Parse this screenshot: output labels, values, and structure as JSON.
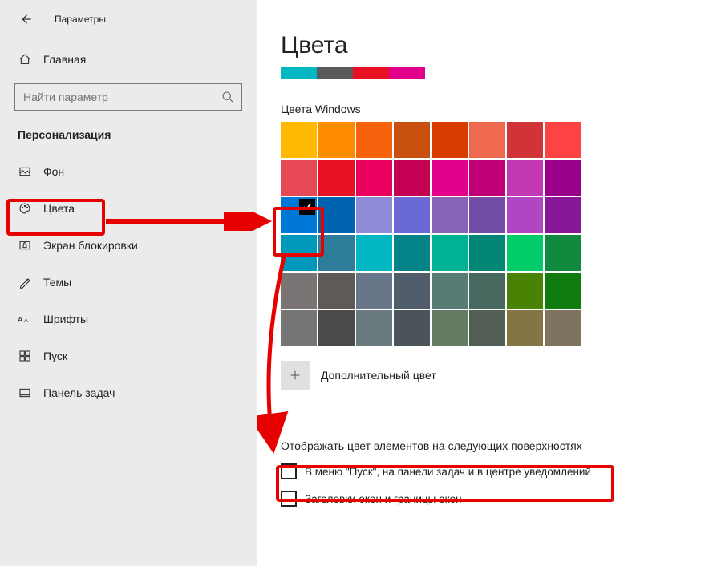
{
  "header": {
    "title": "Параметры"
  },
  "search": {
    "placeholder": "Найти параметр"
  },
  "nav": {
    "home": "Главная",
    "section_title": "Персонализация",
    "items": [
      {
        "label": "Фон"
      },
      {
        "label": "Цвета"
      },
      {
        "label": "Экран блокировки"
      },
      {
        "label": "Темы"
      },
      {
        "label": "Шрифты"
      },
      {
        "label": "Пуск"
      },
      {
        "label": "Панель задач"
      }
    ]
  },
  "page": {
    "title": "Цвета",
    "accent_preview": [
      "#00b7c3",
      "#5a5a5a",
      "#e81123",
      "#e3008c"
    ],
    "windows_colors": "Цвета Windows",
    "custom_color": "Дополнительный цвет",
    "surfaces_head": "Отображать цвет элементов на следующих поверхностях",
    "chk1": "В меню \"Пуск\", на панели задач и в центре уведомлений",
    "chk2": "Заголовки окон и границы окон"
  },
  "palette": {
    "selected_index": 16,
    "colors": [
      "#ffb900",
      "#ff8c00",
      "#f7630c",
      "#ca5010",
      "#da3b01",
      "#ef6950",
      "#d13438",
      "#ff4343",
      "#e74856",
      "#e81123",
      "#ea005e",
      "#c30052",
      "#e3008c",
      "#bf0077",
      "#c239b3",
      "#9a0089",
      "#0078d7",
      "#0063b1",
      "#8e8cd8",
      "#6b69d6",
      "#8764b8",
      "#744da9",
      "#b146c2",
      "#881798",
      "#0099bc",
      "#2d7d9a",
      "#00b7c3",
      "#038387",
      "#00b294",
      "#018574",
      "#00cc6a",
      "#10893e",
      "#7a7574",
      "#5d5a58",
      "#68768a",
      "#515c6b",
      "#567c73",
      "#486860",
      "#498205",
      "#107c10",
      "#767676",
      "#4c4a48",
      "#69797e",
      "#4a5459",
      "#647c64",
      "#525e54",
      "#847545",
      "#7e735f"
    ]
  }
}
